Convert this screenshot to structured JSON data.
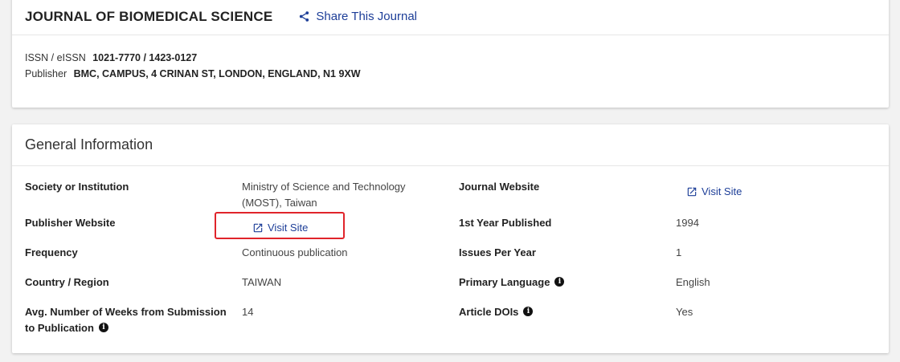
{
  "journal": {
    "title": "JOURNAL OF BIOMEDICAL SCIENCE",
    "share_label": "Share This Journal",
    "issn_label": "ISSN / eISSN",
    "issn_value": "1021-7770 / 1423-0127",
    "publisher_label": "Publisher",
    "publisher_value": "BMC, CAMPUS, 4 CRINAN ST, LONDON, ENGLAND, N1 9XW"
  },
  "general": {
    "heading": "General Information",
    "society_label": "Society or Institution",
    "society_value_line1": "Ministry of Science and Technology",
    "society_value_line2": "(MOST), Taiwan",
    "publisher_website_label": "Publisher Website",
    "publisher_website_link": "Visit Site",
    "frequency_label": "Frequency",
    "frequency_value": "Continuous publication",
    "country_label": "Country / Region",
    "country_value": "TAIWAN",
    "weeks_label_line1": "Avg. Number of Weeks from Submission",
    "weeks_label_line2": "to Publication",
    "weeks_value": "14",
    "journal_website_label": "Journal Website",
    "journal_website_link": "Visit Site",
    "first_year_label": "1st Year Published",
    "first_year_value": "1994",
    "issues_label": "Issues Per Year",
    "issues_value": "1",
    "language_label": "Primary Language",
    "language_value": "English",
    "dois_label": "Article DOIs",
    "dois_value": "Yes"
  },
  "icons": {
    "share": "share-icon",
    "external_link": "external-link-icon",
    "info": "info-icon"
  },
  "colors": {
    "link": "#1d3e98",
    "highlight": "#e0242b"
  }
}
